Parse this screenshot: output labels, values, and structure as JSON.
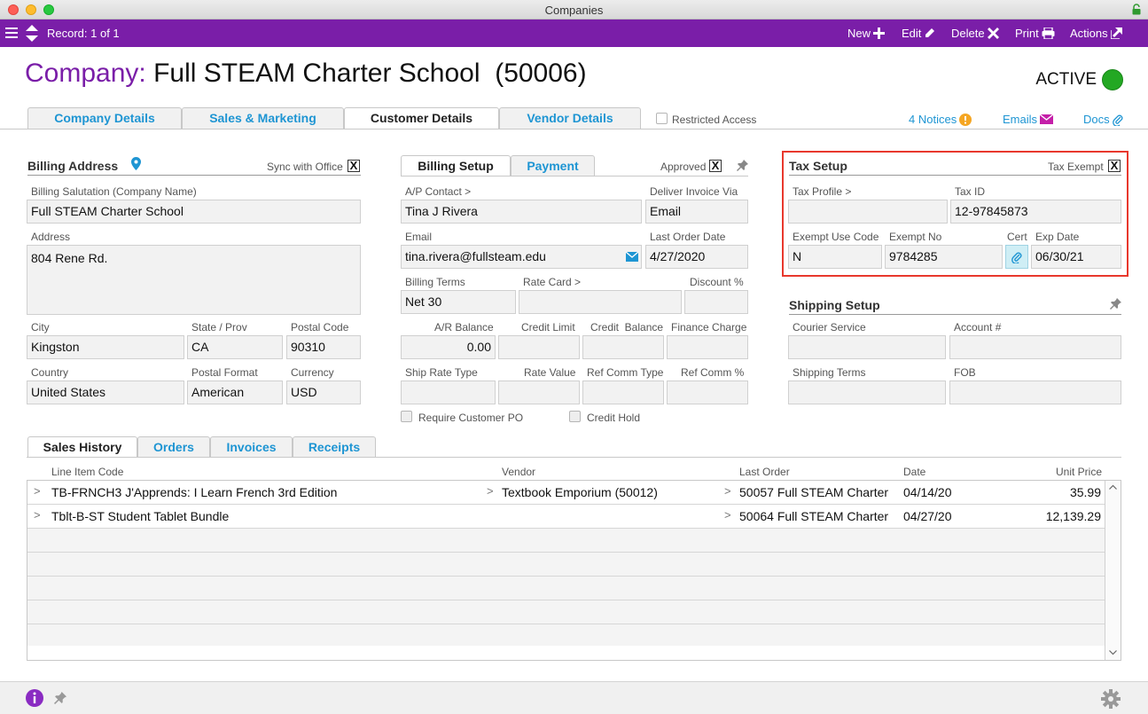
{
  "window": {
    "title": "Companies"
  },
  "toolbar": {
    "record": "Record: 1 of 1",
    "new": "New",
    "edit": "Edit",
    "delete": "Delete",
    "print": "Print",
    "actions": "Actions"
  },
  "header": {
    "prefix": "Company:",
    "name": "Full STEAM Charter School  (50006)",
    "status": "ACTIVE",
    "status_color": "#23a823"
  },
  "tabs": [
    "Company Details",
    "Sales & Marketing",
    "Customer Details",
    "Vendor Details"
  ],
  "active_tab": "Customer Details",
  "restricted_access": "Restricted Access",
  "header_links": {
    "notices": "4 Notices",
    "emails": "Emails",
    "docs": "Docs"
  },
  "billing_address": {
    "title": "Billing Address",
    "sync_label": "Sync with Office",
    "sync_checked": "X",
    "salutation_label": "Billing Salutation (Company Name)",
    "salutation": "Full STEAM Charter School",
    "address_label": "Address",
    "address": "804 Rene Rd.",
    "city_label": "City",
    "city": "Kingston",
    "state_label": "State / Prov",
    "state": "CA",
    "postal_label": "Postal Code",
    "postal": "90310",
    "country_label": "Country",
    "country": "United States",
    "postal_format_label": "Postal Format",
    "postal_format": "American",
    "currency_label": "Currency",
    "currency": "USD"
  },
  "billing_setup": {
    "tabs": [
      "Billing Setup",
      "Payment"
    ],
    "approved_label": "Approved",
    "approved_checked": "X",
    "ap_contact_label": "A/P Contact >",
    "ap_contact": "Tina J Rivera",
    "deliver_label": "Deliver Invoice Via",
    "deliver": "Email",
    "email_label": "Email",
    "email": "tina.rivera@fullsteam.edu",
    "last_order_label": "Last Order Date",
    "last_order": "4/27/2020",
    "terms_label": "Billing Terms",
    "terms": "Net 30",
    "rate_card_label": "Rate Card >",
    "rate_card": "",
    "discount_label": "Discount %",
    "discount": "",
    "ar_balance_label": "A/R Balance",
    "ar_balance": "0.00",
    "credit_limit_label": "Credit Limit",
    "credit_balance_label": "Credit  Balance",
    "finance_charge_label": "Finance Charge",
    "ship_rate_type_label": "Ship Rate Type",
    "rate_value_label": "Rate Value",
    "ref_comm_type_label": "Ref Comm Type",
    "ref_comm_pct_label": "Ref Comm %",
    "require_po_label": "Require Customer PO",
    "credit_hold_label": "Credit Hold"
  },
  "tax_setup": {
    "title": "Tax Setup",
    "exempt_label": "Tax Exempt",
    "exempt_checked": "X",
    "profile_label": "Tax Profile >",
    "profile": "",
    "tax_id_label": "Tax ID",
    "tax_id": "12-97845873",
    "exempt_use_label": "Exempt Use Code",
    "exempt_use": "N",
    "exempt_no_label": "Exempt No",
    "exempt_no": "9784285",
    "cert_label": "Cert",
    "exp_date_label": "Exp Date",
    "exp_date": "06/30/21"
  },
  "shipping_setup": {
    "title": "Shipping Setup",
    "courier_label": "Courier Service",
    "account_label": "Account #",
    "terms_label": "Shipping Terms",
    "fob_label": "FOB"
  },
  "sales_tabs": [
    "Sales History",
    "Orders",
    "Invoices",
    "Receipts"
  ],
  "sales_history": {
    "columns": [
      "Line Item Code",
      "Vendor",
      "Last Order",
      "Date",
      "Unit Price"
    ],
    "rows": [
      {
        "code": "TB-FRNCH3 J'Apprends: I Learn French 3rd Edition",
        "vendor": "Textbook Emporium  (50012)",
        "last_order": "50057 Full STEAM Charter",
        "date": "04/14/20",
        "price": "35.99"
      },
      {
        "code": "Tblt-B-ST Student Tablet Bundle",
        "vendor": "",
        "last_order": "50064 Full STEAM Charter",
        "date": "04/27/20",
        "price": "12,139.29"
      }
    ]
  }
}
